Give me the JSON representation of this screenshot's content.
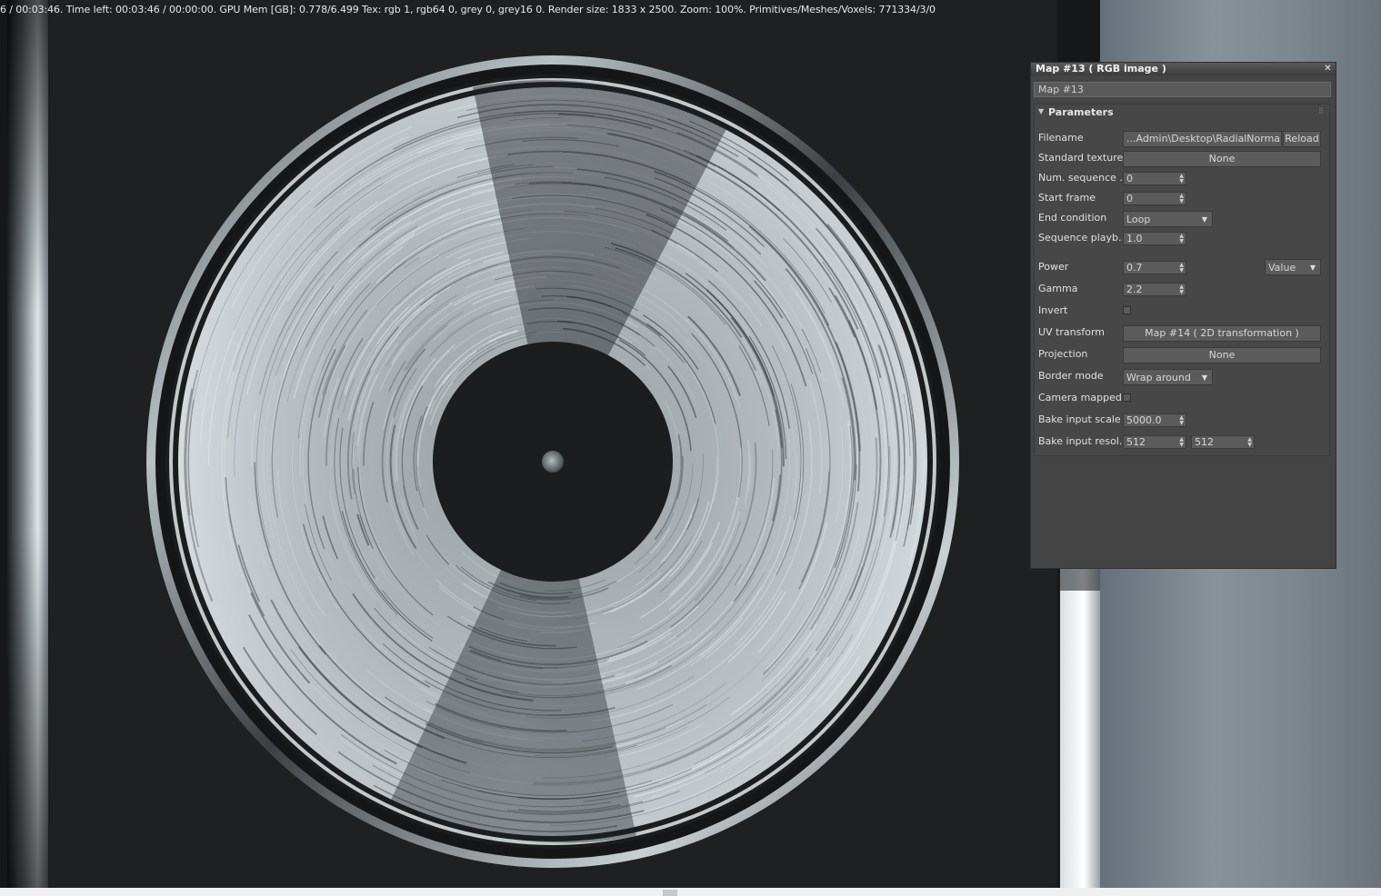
{
  "status_line": "6 / 00:03:46.   Time left: 00:03:46 / 00:00:00.   GPU Mem [GB]: 0.778/6.499   Tex: rgb 1, rgb64 0, grey 0, grey16 0.   Render size: 1833 x 2500.   Zoom: 100%.   Primitives/Meshes/Voxels: 771334/3/0",
  "panel": {
    "title": "Map #13  ( RGB image )",
    "name": "Map #13",
    "rollout_title": "Parameters",
    "params": {
      "filename": {
        "label": "Filename",
        "value": "...Admin\\Desktop\\RadialNormal.jpg",
        "reload": "Reload"
      },
      "standard_texture": {
        "label": "Standard texture",
        "value": "None"
      },
      "num_sequence": {
        "label": "Num. sequence ...",
        "value": "0"
      },
      "start_frame": {
        "label": "Start frame",
        "value": "0"
      },
      "end_condition": {
        "label": "End condition",
        "value": "Loop"
      },
      "sequence_playback": {
        "label": "Sequence playb...",
        "value": "1.0"
      },
      "power": {
        "label": "Power",
        "value": "0.7",
        "mode": "Value"
      },
      "gamma": {
        "label": "Gamma",
        "value": "2.2"
      },
      "invert": {
        "label": "Invert",
        "checked": false
      },
      "uv_transform": {
        "label": "UV transform",
        "value": "Map #14  ( 2D transformation )"
      },
      "projection": {
        "label": "Projection",
        "value": "None"
      },
      "border_mode": {
        "label": "Border mode",
        "value": "Wrap around"
      },
      "camera_mapped": {
        "label": "Camera mapped",
        "checked": false
      },
      "bake_input_scale": {
        "label": "Bake input scale",
        "value": "5000.0"
      },
      "bake_input_resolution": {
        "label": "Bake input resol...",
        "x": "512",
        "y": "512"
      }
    }
  },
  "icons": {
    "close": "close-icon",
    "rollout": "rollout-collapse-icon",
    "spinner": "spinner-icon",
    "dropdown": "chevron-down-icon"
  }
}
